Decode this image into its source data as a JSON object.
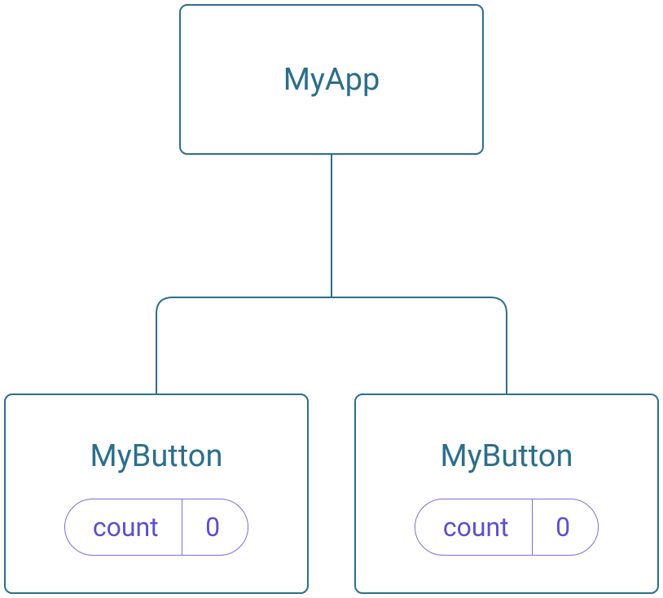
{
  "diagram": {
    "root": {
      "label": "MyApp"
    },
    "children": [
      {
        "label": "MyButton",
        "state": {
          "name": "count",
          "value": "0"
        }
      },
      {
        "label": "MyButton",
        "state": {
          "name": "count",
          "value": "0"
        }
      }
    ]
  }
}
